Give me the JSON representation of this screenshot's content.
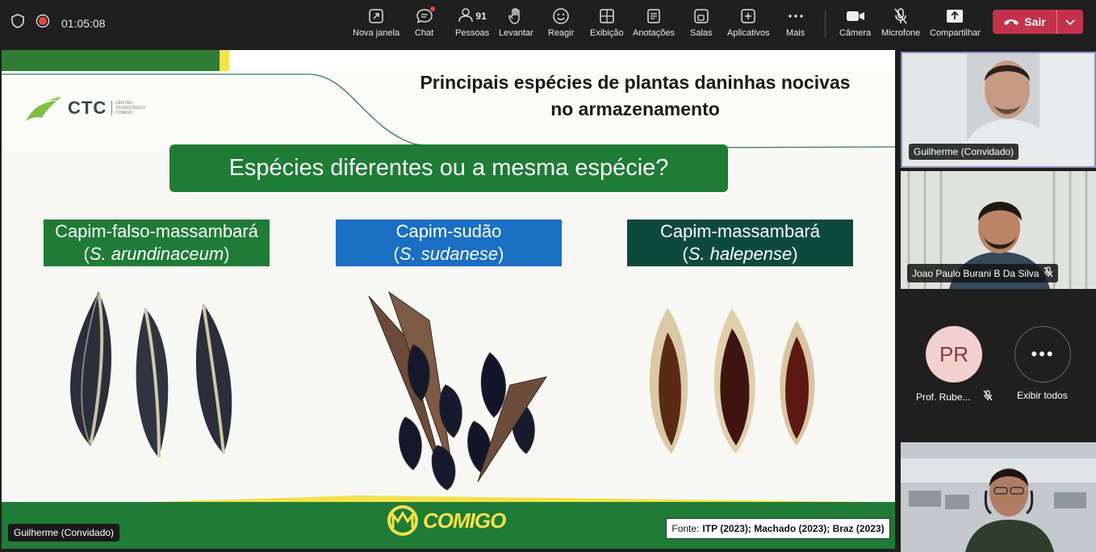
{
  "topbar": {
    "timer": "01:05:08",
    "items": [
      {
        "label": "Nova janela",
        "icon": "new-window-icon"
      },
      {
        "label": "Chat",
        "icon": "chat-icon"
      },
      {
        "label": "Pessoas",
        "icon": "people-icon",
        "count": "91"
      },
      {
        "label": "Levantar",
        "icon": "raise-hand-icon"
      },
      {
        "label": "Reagir",
        "icon": "react-icon"
      },
      {
        "label": "Exibição",
        "icon": "view-icon"
      },
      {
        "label": "Anotações",
        "icon": "notes-icon"
      },
      {
        "label": "Salas",
        "icon": "rooms-icon"
      },
      {
        "label": "Aplicativos",
        "icon": "apps-icon"
      },
      {
        "label": "Mais",
        "icon": "more-icon"
      },
      {
        "label": "Câmera",
        "icon": "camera-icon"
      },
      {
        "label": "Microfone",
        "icon": "mic-muted-icon"
      },
      {
        "label": "Compartilhar",
        "icon": "share-icon"
      }
    ],
    "leave_label": "Sair",
    "leave_color": "#c4314b"
  },
  "slide": {
    "title_line1": "Principais espécies de plantas daninhas nocivas",
    "title_line2": "no armazenamento",
    "logo_text": "CTC",
    "logo_subtext": "CENTRO TECNOLÓGICO COMIGO",
    "question": "Espécies diferentes ou a mesma espécie?",
    "species": [
      {
        "common": "Capim-falso-massambará",
        "sci_prefix": "(",
        "sci": "S. arundinaceum",
        "sci_suffix": ")",
        "color": "#1e7c35"
      },
      {
        "common": "Capim-sudão",
        "sci_prefix": "(",
        "sci": "S. sudanese",
        "sci_suffix": ")",
        "color": "#1a6fc2"
      },
      {
        "common": "Capim-massambará",
        "sci_prefix": "(",
        "sci": "S. halepense",
        "sci_suffix": ")",
        "color": "#0d4a3e"
      }
    ],
    "brand": "COMIGO",
    "source_prefix": "Fonte:",
    "source_refs": "ITP (2023); Machado (2023); Braz (2023)",
    "presenter_tag": "Guilherme (Convidado)"
  },
  "participants": {
    "tile1": "Guilherme (Convidado)",
    "tile2": "Joao Paulo Burani B Da Silva",
    "avatar_initials": "PR",
    "avatar_name": "Prof. Rube...",
    "show_all": "Exibir todos"
  }
}
